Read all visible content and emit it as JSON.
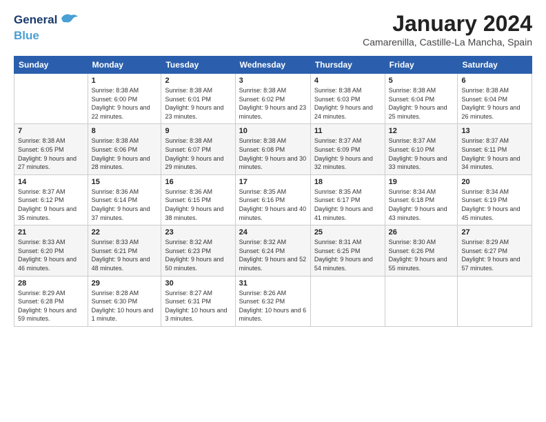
{
  "header": {
    "logo_general": "General",
    "logo_blue": "Blue",
    "main_title": "January 2024",
    "subtitle": "Camarenilla, Castille-La Mancha, Spain"
  },
  "weekdays": [
    "Sunday",
    "Monday",
    "Tuesday",
    "Wednesday",
    "Thursday",
    "Friday",
    "Saturday"
  ],
  "weeks": [
    [
      {
        "day": "",
        "sunrise": "",
        "sunset": "",
        "daylight": ""
      },
      {
        "day": "1",
        "sunrise": "Sunrise: 8:38 AM",
        "sunset": "Sunset: 6:00 PM",
        "daylight": "Daylight: 9 hours and 22 minutes."
      },
      {
        "day": "2",
        "sunrise": "Sunrise: 8:38 AM",
        "sunset": "Sunset: 6:01 PM",
        "daylight": "Daylight: 9 hours and 23 minutes."
      },
      {
        "day": "3",
        "sunrise": "Sunrise: 8:38 AM",
        "sunset": "Sunset: 6:02 PM",
        "daylight": "Daylight: 9 hours and 23 minutes."
      },
      {
        "day": "4",
        "sunrise": "Sunrise: 8:38 AM",
        "sunset": "Sunset: 6:03 PM",
        "daylight": "Daylight: 9 hours and 24 minutes."
      },
      {
        "day": "5",
        "sunrise": "Sunrise: 8:38 AM",
        "sunset": "Sunset: 6:04 PM",
        "daylight": "Daylight: 9 hours and 25 minutes."
      },
      {
        "day": "6",
        "sunrise": "Sunrise: 8:38 AM",
        "sunset": "Sunset: 6:04 PM",
        "daylight": "Daylight: 9 hours and 26 minutes."
      }
    ],
    [
      {
        "day": "7",
        "sunrise": "Sunrise: 8:38 AM",
        "sunset": "Sunset: 6:05 PM",
        "daylight": "Daylight: 9 hours and 27 minutes."
      },
      {
        "day": "8",
        "sunrise": "Sunrise: 8:38 AM",
        "sunset": "Sunset: 6:06 PM",
        "daylight": "Daylight: 9 hours and 28 minutes."
      },
      {
        "day": "9",
        "sunrise": "Sunrise: 8:38 AM",
        "sunset": "Sunset: 6:07 PM",
        "daylight": "Daylight: 9 hours and 29 minutes."
      },
      {
        "day": "10",
        "sunrise": "Sunrise: 8:38 AM",
        "sunset": "Sunset: 6:08 PM",
        "daylight": "Daylight: 9 hours and 30 minutes."
      },
      {
        "day": "11",
        "sunrise": "Sunrise: 8:37 AM",
        "sunset": "Sunset: 6:09 PM",
        "daylight": "Daylight: 9 hours and 32 minutes."
      },
      {
        "day": "12",
        "sunrise": "Sunrise: 8:37 AM",
        "sunset": "Sunset: 6:10 PM",
        "daylight": "Daylight: 9 hours and 33 minutes."
      },
      {
        "day": "13",
        "sunrise": "Sunrise: 8:37 AM",
        "sunset": "Sunset: 6:11 PM",
        "daylight": "Daylight: 9 hours and 34 minutes."
      }
    ],
    [
      {
        "day": "14",
        "sunrise": "Sunrise: 8:37 AM",
        "sunset": "Sunset: 6:12 PM",
        "daylight": "Daylight: 9 hours and 35 minutes."
      },
      {
        "day": "15",
        "sunrise": "Sunrise: 8:36 AM",
        "sunset": "Sunset: 6:14 PM",
        "daylight": "Daylight: 9 hours and 37 minutes."
      },
      {
        "day": "16",
        "sunrise": "Sunrise: 8:36 AM",
        "sunset": "Sunset: 6:15 PM",
        "daylight": "Daylight: 9 hours and 38 minutes."
      },
      {
        "day": "17",
        "sunrise": "Sunrise: 8:35 AM",
        "sunset": "Sunset: 6:16 PM",
        "daylight": "Daylight: 9 hours and 40 minutes."
      },
      {
        "day": "18",
        "sunrise": "Sunrise: 8:35 AM",
        "sunset": "Sunset: 6:17 PM",
        "daylight": "Daylight: 9 hours and 41 minutes."
      },
      {
        "day": "19",
        "sunrise": "Sunrise: 8:34 AM",
        "sunset": "Sunset: 6:18 PM",
        "daylight": "Daylight: 9 hours and 43 minutes."
      },
      {
        "day": "20",
        "sunrise": "Sunrise: 8:34 AM",
        "sunset": "Sunset: 6:19 PM",
        "daylight": "Daylight: 9 hours and 45 minutes."
      }
    ],
    [
      {
        "day": "21",
        "sunrise": "Sunrise: 8:33 AM",
        "sunset": "Sunset: 6:20 PM",
        "daylight": "Daylight: 9 hours and 46 minutes."
      },
      {
        "day": "22",
        "sunrise": "Sunrise: 8:33 AM",
        "sunset": "Sunset: 6:21 PM",
        "daylight": "Daylight: 9 hours and 48 minutes."
      },
      {
        "day": "23",
        "sunrise": "Sunrise: 8:32 AM",
        "sunset": "Sunset: 6:23 PM",
        "daylight": "Daylight: 9 hours and 50 minutes."
      },
      {
        "day": "24",
        "sunrise": "Sunrise: 8:32 AM",
        "sunset": "Sunset: 6:24 PM",
        "daylight": "Daylight: 9 hours and 52 minutes."
      },
      {
        "day": "25",
        "sunrise": "Sunrise: 8:31 AM",
        "sunset": "Sunset: 6:25 PM",
        "daylight": "Daylight: 9 hours and 54 minutes."
      },
      {
        "day": "26",
        "sunrise": "Sunrise: 8:30 AM",
        "sunset": "Sunset: 6:26 PM",
        "daylight": "Daylight: 9 hours and 55 minutes."
      },
      {
        "day": "27",
        "sunrise": "Sunrise: 8:29 AM",
        "sunset": "Sunset: 6:27 PM",
        "daylight": "Daylight: 9 hours and 57 minutes."
      }
    ],
    [
      {
        "day": "28",
        "sunrise": "Sunrise: 8:29 AM",
        "sunset": "Sunset: 6:28 PM",
        "daylight": "Daylight: 9 hours and 59 minutes."
      },
      {
        "day": "29",
        "sunrise": "Sunrise: 8:28 AM",
        "sunset": "Sunset: 6:30 PM",
        "daylight": "Daylight: 10 hours and 1 minute."
      },
      {
        "day": "30",
        "sunrise": "Sunrise: 8:27 AM",
        "sunset": "Sunset: 6:31 PM",
        "daylight": "Daylight: 10 hours and 3 minutes."
      },
      {
        "day": "31",
        "sunrise": "Sunrise: 8:26 AM",
        "sunset": "Sunset: 6:32 PM",
        "daylight": "Daylight: 10 hours and 6 minutes."
      },
      {
        "day": "",
        "sunrise": "",
        "sunset": "",
        "daylight": ""
      },
      {
        "day": "",
        "sunrise": "",
        "sunset": "",
        "daylight": ""
      },
      {
        "day": "",
        "sunrise": "",
        "sunset": "",
        "daylight": ""
      }
    ]
  ]
}
